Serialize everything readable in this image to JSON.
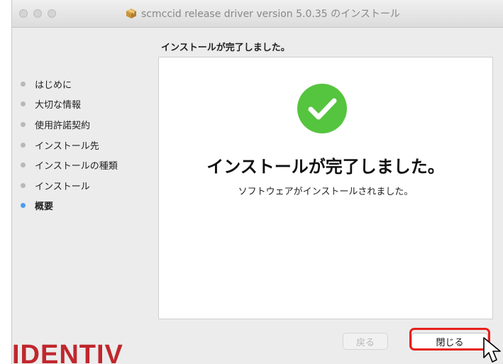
{
  "window": {
    "title": "scmccid release driver version 5.0.35 のインストール",
    "heading": "インストールが完了しました。"
  },
  "sidebar": {
    "steps": [
      {
        "label": "はじめに",
        "active": false
      },
      {
        "label": "大切な情報",
        "active": false
      },
      {
        "label": "使用許諾契約",
        "active": false
      },
      {
        "label": "インストール先",
        "active": false
      },
      {
        "label": "インストールの種類",
        "active": false
      },
      {
        "label": "インストール",
        "active": false
      },
      {
        "label": "概要",
        "active": true
      }
    ]
  },
  "content": {
    "title": "インストールが完了しました。",
    "message": "ソフトウェアがインストールされました。",
    "icon": "checkmark-icon",
    "icon_color": "#55c43e"
  },
  "buttons": {
    "back_label": "戻る",
    "close_label": "閉じる"
  },
  "logo": {
    "text": "IDENTIV",
    "color": "#c0272d"
  },
  "colors": {
    "highlight": "#e8201b",
    "active_step": "#4b9ded"
  }
}
